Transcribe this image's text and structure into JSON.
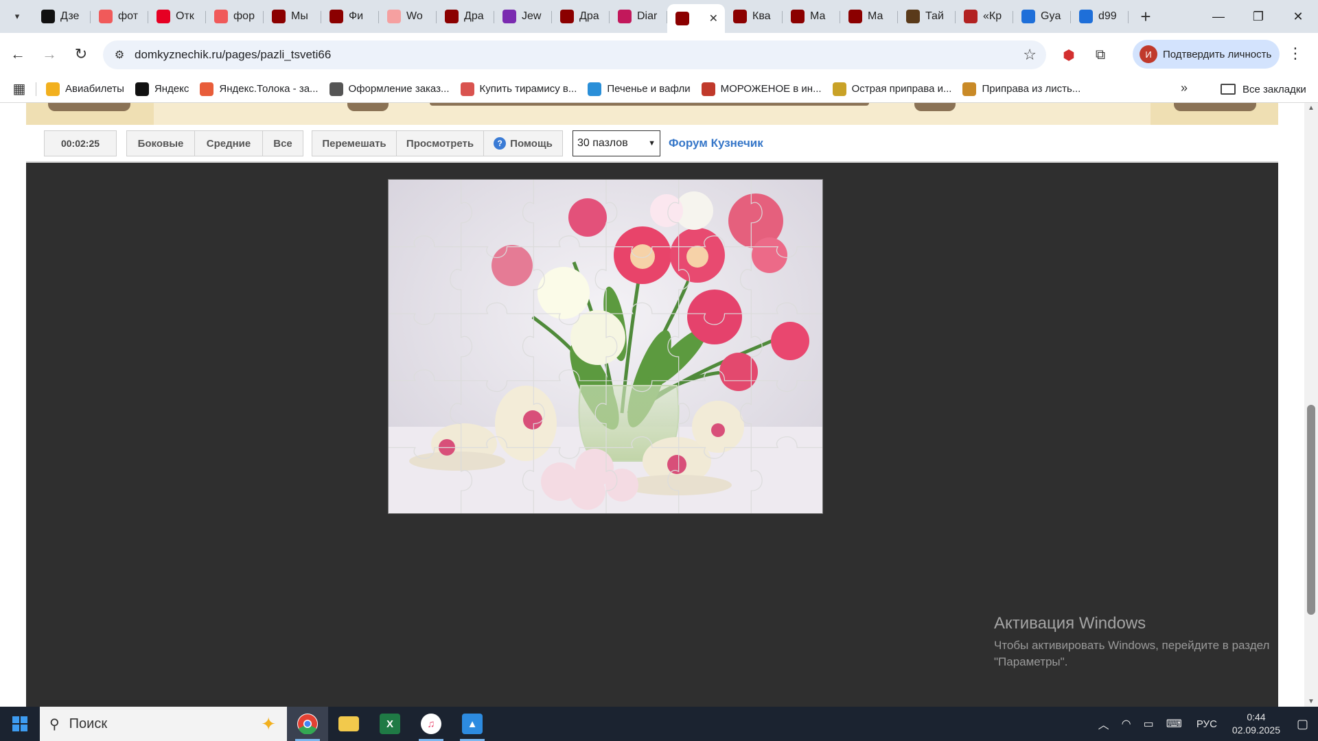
{
  "tabs": [
    {
      "title": "Дзе",
      "icon": "yandex-zen-icon",
      "color": "#111111"
    },
    {
      "title": "фот",
      "icon": "yandex-icon",
      "color": "#f05a5a"
    },
    {
      "title": "Отк",
      "icon": "pinterest-icon",
      "color": "#e60023"
    },
    {
      "title": "фор",
      "icon": "yandex-icon",
      "color": "#f05a5a"
    },
    {
      "title": "Мы",
      "icon": "domkuznechik-icon",
      "color": "#8b0000"
    },
    {
      "title": "Фи",
      "icon": "domkuznechik-icon",
      "color": "#8b0000"
    },
    {
      "title": "Wo",
      "icon": "word-icon",
      "color": "#f5a0a0"
    },
    {
      "title": "Дра",
      "icon": "domkuznechik-icon",
      "color": "#8b0000"
    },
    {
      "title": "Jew",
      "icon": "game-icon",
      "color": "#7a2bb0"
    },
    {
      "title": "Дра",
      "icon": "domkuznechik-icon",
      "color": "#8b0000"
    },
    {
      "title": "Diar",
      "icon": "diary-icon",
      "color": "#c2185b"
    },
    {
      "title": "",
      "icon": "domkuznechik-icon",
      "color": "#8b0000",
      "active": true
    },
    {
      "title": "Ква",
      "icon": "domkuznechik-icon",
      "color": "#8b0000"
    },
    {
      "title": "Ма",
      "icon": "domkuznechik-icon",
      "color": "#8b0000"
    },
    {
      "title": "Ма",
      "icon": "domkuznechik-icon",
      "color": "#8b0000"
    },
    {
      "title": "Тай",
      "icon": "tai-icon",
      "color": "#5a3a1a"
    },
    {
      "title": "«Кр",
      "icon": "kr-icon",
      "color": "#b22222"
    },
    {
      "title": "Gya",
      "icon": "gya-icon",
      "color": "#1e6fd9"
    },
    {
      "title": "d99",
      "icon": "d99-icon",
      "color": "#1e6fd9"
    }
  ],
  "omnibox": {
    "url": "domkyznechik.ru/pages/pazli_tsveti66"
  },
  "profile": {
    "label": "Подтвердить личность",
    "initial": "И"
  },
  "bookmarks": [
    {
      "label": "Авиабилеты",
      "icon": "plane-icon",
      "color": "#f2b01e"
    },
    {
      "label": "Яндекс",
      "icon": "yandex-icon",
      "color": "#111111"
    },
    {
      "label": "Яндекс.Толока - за...",
      "icon": "toloka-icon",
      "color": "#e85d3a"
    },
    {
      "label": "Оформление заказ...",
      "icon": "globe-icon",
      "color": "#555555"
    },
    {
      "label": "Купить тирамису в...",
      "icon": "cake-icon",
      "color": "#d9534f"
    },
    {
      "label": "Печенье и вафли",
      "icon": "cookie-icon",
      "color": "#2a8fd8"
    },
    {
      "label": "МОРОЖЕНОЕ в ин...",
      "icon": "d-icon",
      "color": "#c0392b"
    },
    {
      "label": "Острая приправа и...",
      "icon": "spice-icon",
      "color": "#c9a227"
    },
    {
      "label": "Приправа из листь...",
      "icon": "herb-icon",
      "color": "#c98a27"
    }
  ],
  "bookmarks_all": "Все закладки",
  "controls": {
    "timer": "00:02:25",
    "side": "Боковые",
    "middle": "Средние",
    "all": "Все",
    "shuffle": "Перемешать",
    "preview": "Просмотреть",
    "help": "Помощь",
    "pieces": "30 пазлов",
    "forum": "Форум Кузнечик"
  },
  "puzzle": {
    "rows": 5,
    "cols": 6
  },
  "activation": {
    "title": "Активация Windows",
    "subtitle": "Чтобы активировать Windows, перейдите в раздел \"Параметры\"."
  },
  "taskbar": {
    "search_placeholder": "Поиск",
    "lang": "РУС",
    "time": "0:44",
    "date": "02.09.2025"
  }
}
